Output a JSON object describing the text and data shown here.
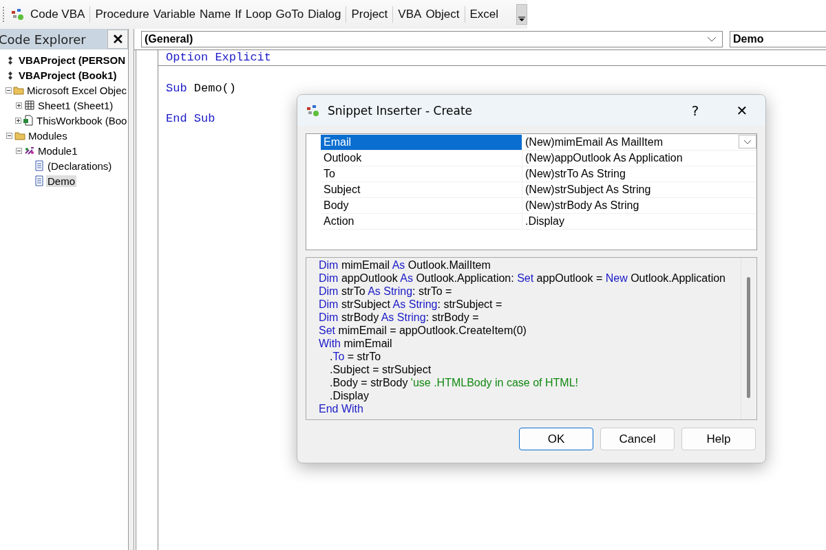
{
  "toolbar": {
    "groups": [
      [
        "Code VBA"
      ],
      [
        "Procedure",
        "Variable",
        "Name",
        "If",
        "Loop",
        "GoTo",
        "Dialog"
      ],
      [
        "Project"
      ],
      [
        "VBA",
        "Object"
      ],
      [
        "Excel"
      ]
    ]
  },
  "explorer": {
    "title": "Code Explorer",
    "close": "✕",
    "tree": [
      {
        "label": "VBAProject (PERSON",
        "kind": "project",
        "selected": false
      },
      {
        "label": "VBAProject (Book1)",
        "kind": "project",
        "selected": false,
        "children": [
          {
            "label": "Microsoft Excel Objec",
            "kind": "folder",
            "expanded": true,
            "selected": false,
            "children": [
              {
                "label": "Sheet1 (Sheet1)",
                "kind": "sheet",
                "expanded": false,
                "selected": false
              },
              {
                "label": "ThisWorkbook (Boo",
                "kind": "workbook",
                "expanded": false,
                "selected": false
              }
            ]
          },
          {
            "label": "Modules",
            "kind": "folder",
            "expanded": true,
            "selected": false,
            "children": [
              {
                "label": "Module1",
                "kind": "module",
                "expanded": true,
                "selected": false,
                "children": [
                  {
                    "label": "(Declarations)",
                    "kind": "procedure",
                    "selected": false
                  },
                  {
                    "label": "Demo",
                    "kind": "procedure",
                    "selected": true
                  }
                ]
              }
            ]
          }
        ]
      }
    ]
  },
  "editor": {
    "object_combo": "(General)",
    "procedure_combo": "Demo",
    "lines": [
      {
        "divider": true,
        "segments": [
          {
            "text": "Option Explicit",
            "kind": "keyword"
          }
        ]
      },
      {
        "divider": false
      },
      {
        "divider": false,
        "segments": [
          {
            "text": "Sub",
            "kind": "keyword"
          },
          {
            "text": " Demo()",
            "kind": "plain"
          }
        ]
      },
      {
        "divider": false
      },
      {
        "divider": false,
        "segments": [
          {
            "text": "End Sub",
            "kind": "keyword"
          }
        ]
      }
    ]
  },
  "dialog": {
    "title": "Snippet Inserter - Create",
    "help": "?",
    "close": "✕",
    "properties": [
      {
        "name": "Email",
        "value": "(New)mimEmail As MailItem",
        "selected": true
      },
      {
        "name": "Outlook",
        "value": "(New)appOutlook As Application",
        "selected": false
      },
      {
        "name": "To",
        "value": "(New)strTo As String",
        "selected": false
      },
      {
        "name": "Subject",
        "value": "(New)strSubject As String",
        "selected": false
      },
      {
        "name": "Body",
        "value": "(New)strBody As String",
        "selected": false
      },
      {
        "name": "Action",
        "value": ".Display",
        "selected": false
      }
    ],
    "code": [
      {
        "indented": false,
        "segments": [
          {
            "text": "Dim",
            "kind": "keyword"
          },
          {
            "text": " mimEmail ",
            "kind": "plain"
          },
          {
            "text": "As",
            "kind": "keyword"
          },
          {
            "text": " Outlook.MailItem",
            "kind": "plain"
          }
        ]
      },
      {
        "indented": false,
        "segments": [
          {
            "text": "Dim",
            "kind": "keyword"
          },
          {
            "text": " appOutlook ",
            "kind": "plain"
          },
          {
            "text": "As",
            "kind": "keyword"
          },
          {
            "text": " Outlook.Application: ",
            "kind": "plain"
          },
          {
            "text": "Set",
            "kind": "keyword"
          },
          {
            "text": " appOutlook = ",
            "kind": "plain"
          },
          {
            "text": "New",
            "kind": "keyword"
          },
          {
            "text": " Outlook.Application",
            "kind": "plain"
          }
        ]
      },
      {
        "indented": false,
        "segments": [
          {
            "text": "Dim",
            "kind": "keyword"
          },
          {
            "text": " strTo ",
            "kind": "plain"
          },
          {
            "text": "As String",
            "kind": "keyword"
          },
          {
            "text": ": strTo =",
            "kind": "plain"
          }
        ]
      },
      {
        "indented": false,
        "segments": [
          {
            "text": "Dim",
            "kind": "keyword"
          },
          {
            "text": " strSubject ",
            "kind": "plain"
          },
          {
            "text": "As String",
            "kind": "keyword"
          },
          {
            "text": ": strSubject =",
            "kind": "plain"
          }
        ]
      },
      {
        "indented": false,
        "segments": [
          {
            "text": "Dim",
            "kind": "keyword"
          },
          {
            "text": " strBody ",
            "kind": "plain"
          },
          {
            "text": "As String",
            "kind": "keyword"
          },
          {
            "text": ": strBody =",
            "kind": "plain"
          }
        ]
      },
      {
        "indented": false,
        "segments": [
          {
            "text": "Set",
            "kind": "keyword"
          },
          {
            "text": " mimEmail = appOutlook.CreateItem(0)",
            "kind": "plain"
          }
        ]
      },
      {
        "indented": false,
        "segments": [
          {
            "text": "With",
            "kind": "keyword"
          },
          {
            "text": " mimEmail",
            "kind": "plain"
          }
        ]
      },
      {
        "indented": true,
        "segments": [
          {
            "text": ".",
            "kind": "plain"
          },
          {
            "text": "To",
            "kind": "keyword"
          },
          {
            "text": " = strTo",
            "kind": "plain"
          }
        ]
      },
      {
        "indented": true,
        "segments": [
          {
            "text": ".Subject = strSubject",
            "kind": "plain"
          }
        ]
      },
      {
        "indented": true,
        "segments": [
          {
            "text": ".Body = strBody ",
            "kind": "plain"
          },
          {
            "text": "'use .HTMLBody in case of HTML!",
            "kind": "comment"
          }
        ]
      },
      {
        "indented": true,
        "segments": [
          {
            "text": ".Display",
            "kind": "plain"
          }
        ]
      },
      {
        "indented": false,
        "segments": [
          {
            "text": "End With",
            "kind": "keyword"
          }
        ]
      }
    ],
    "buttons": [
      {
        "label": "OK",
        "default": true
      },
      {
        "label": "Cancel",
        "default": false
      },
      {
        "label": "Help",
        "default": false
      }
    ]
  }
}
